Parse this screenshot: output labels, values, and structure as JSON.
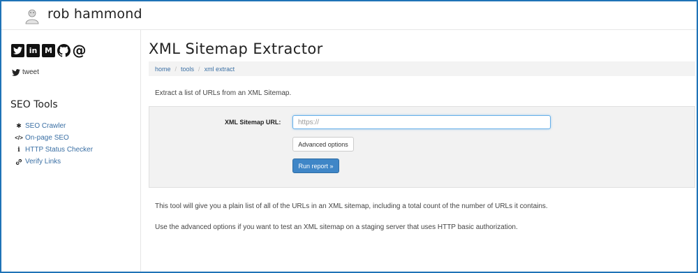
{
  "header": {
    "site_title": "rob hammond"
  },
  "sidebar": {
    "social": [
      {
        "icon": "twitter-icon",
        "glyph": "t"
      },
      {
        "icon": "linkedin-icon",
        "glyph": "in"
      },
      {
        "icon": "medium-icon",
        "glyph": "M"
      },
      {
        "icon": "github-icon",
        "glyph": "gh"
      },
      {
        "icon": "email-icon",
        "glyph": "@"
      }
    ],
    "tweet_label": "tweet",
    "heading": "SEO Tools",
    "tools": [
      {
        "label": "SEO Crawler",
        "icon": "spider-icon"
      },
      {
        "label": "On-page SEO",
        "icon": "code-icon"
      },
      {
        "label": "HTTP Status Checker",
        "icon": "info-icon"
      },
      {
        "label": "Verify Links",
        "icon": "link-icon"
      }
    ]
  },
  "main": {
    "title": "XML Sitemap Extractor",
    "breadcrumb": [
      "home",
      "tools",
      "xml extract"
    ],
    "intro": "Extract a list of URLs from an XML Sitemap.",
    "form": {
      "url_label": "XML Sitemap URL:",
      "url_placeholder": "https://",
      "url_value": "",
      "advanced_label": "Advanced options",
      "run_label": "Run report »"
    },
    "description": [
      "This tool will give you a plain list of all of the URLs in an XML sitemap, including a total count of the number of URLs it contains.",
      "Use the advanced options if you want to test an XML sitemap on a staging server that uses HTTP basic authorization."
    ]
  },
  "colors": {
    "frame_border": "#1f73b7",
    "link": "#3a6fa4",
    "primary_button": "#3f86c7",
    "input_focus": "#66afe9"
  }
}
